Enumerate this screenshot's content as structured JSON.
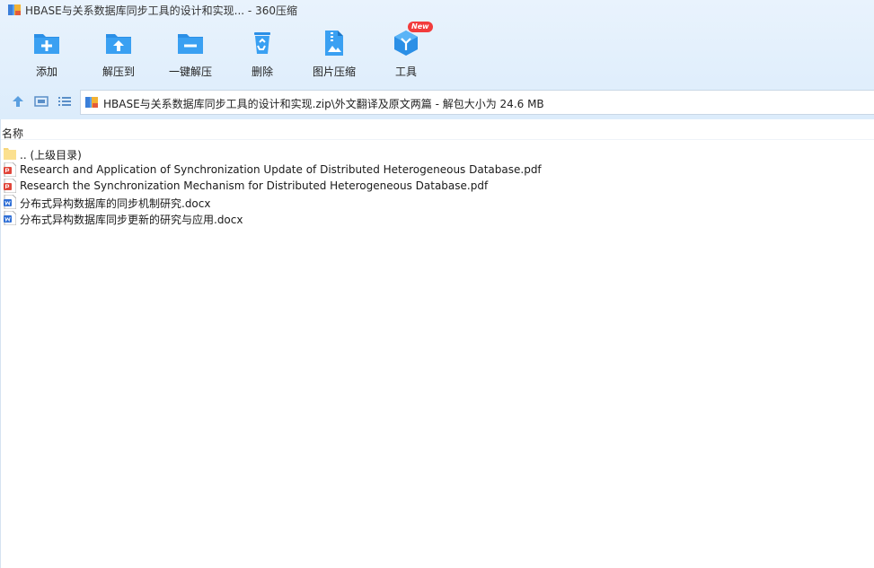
{
  "window": {
    "title": "HBASE与关系数据库同步工具的设计和实现... - 360压缩"
  },
  "toolbar": {
    "items": [
      {
        "label": "添加",
        "icon": "add-folder-icon"
      },
      {
        "label": "解压到",
        "icon": "extract-to-icon"
      },
      {
        "label": "一键解压",
        "icon": "one-click-extract-icon"
      },
      {
        "label": "删除",
        "icon": "recycle-bin-icon"
      },
      {
        "label": "图片压缩",
        "icon": "image-compress-icon"
      },
      {
        "label": "工具",
        "icon": "tools-cube-icon",
        "badge": "New"
      }
    ]
  },
  "address": {
    "path": "HBASE与关系数据库同步工具的设计和实现.zip\\外文翻译及原文两篇 - 解包大小为 24.6 MB"
  },
  "file_list": {
    "column_name": "名称",
    "rows": [
      {
        "name": ".. (上级目录)",
        "type": "folder"
      },
      {
        "name": "Research and Application of Synchronization Update of  Distributed Heterogeneous Database.pdf",
        "type": "pdf"
      },
      {
        "name": "Research the Synchronization Mechanism for Distributed Heterogeneous Database.pdf",
        "type": "pdf"
      },
      {
        "name": "分布式异构数据库的同步机制研究.docx",
        "type": "docx"
      },
      {
        "name": "分布式异构数据库同步更新的研究与应用.docx",
        "type": "docx"
      }
    ]
  },
  "colors": {
    "accent": "#2b8fe6",
    "toolbar_bg": "#e3effc",
    "pdf_red": "#e0463a",
    "docx_blue": "#2f6fd6",
    "badge_red": "#f23c3c"
  }
}
